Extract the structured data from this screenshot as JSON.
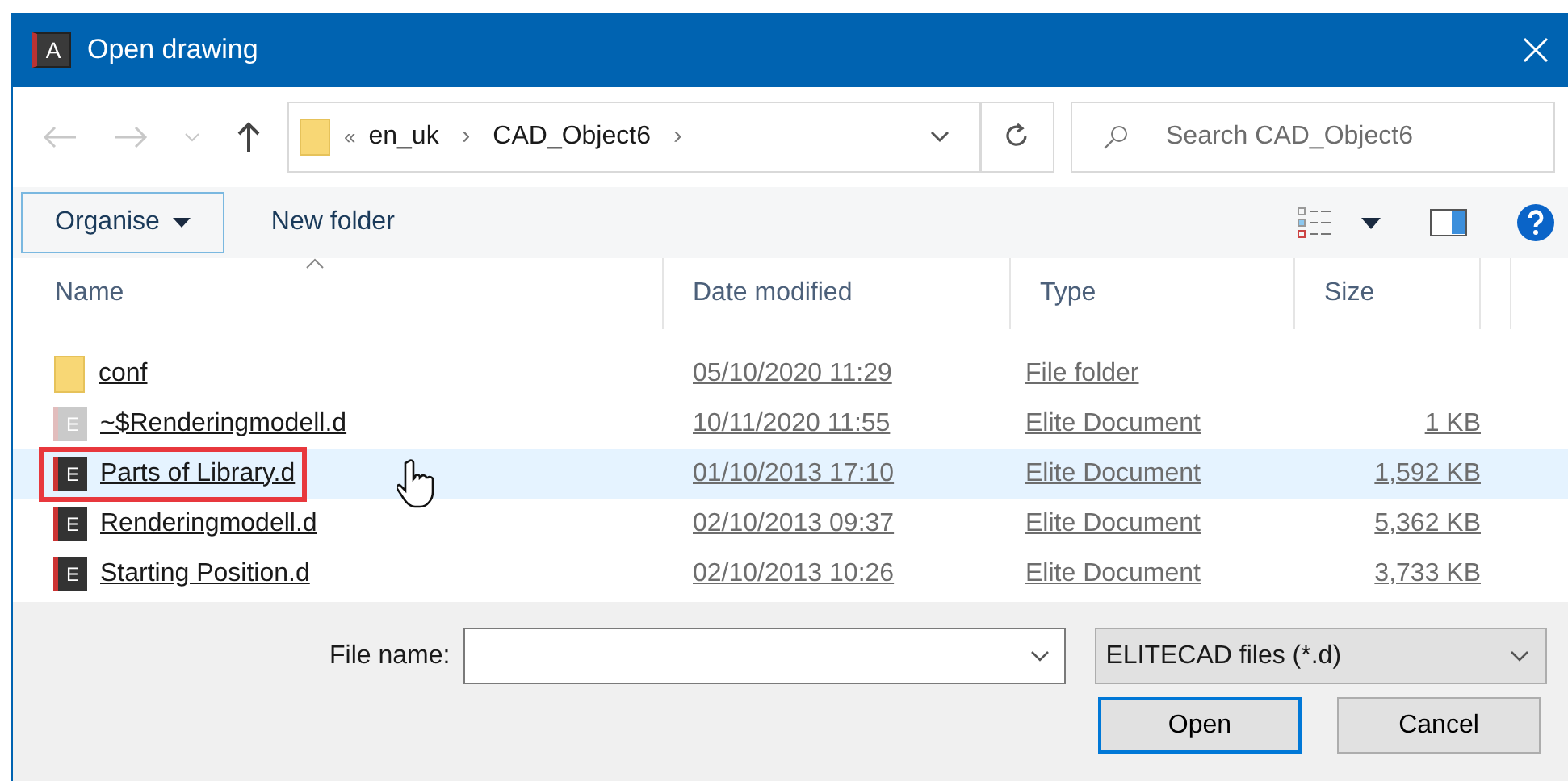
{
  "window": {
    "title": "Open drawing",
    "app_icon_letter": "A"
  },
  "navigation": {
    "overflow_marker": "«",
    "path": [
      {
        "label": "en_uk",
        "separator": "›"
      },
      {
        "label": "CAD_Object6",
        "separator": "›"
      }
    ],
    "search_placeholder": "Search CAD_Object6"
  },
  "toolbar": {
    "buttons": [
      {
        "label": "Organise",
        "dropdown": true,
        "focused": true
      },
      {
        "label": "New folder",
        "dropdown": false,
        "focused": false
      }
    ]
  },
  "table": {
    "columns": [
      {
        "label": "Name",
        "sorted": true
      },
      {
        "label": "Date modified",
        "sorted": false
      },
      {
        "label": "Type",
        "sorted": false
      },
      {
        "label": "Size",
        "sorted": false
      }
    ],
    "rows": [
      {
        "kind": "folder",
        "name": "conf",
        "date": "05/10/2020 11:29",
        "type": "File folder",
        "dimmed": false,
        "hovered": false,
        "outlined": false
      },
      {
        "kind": "document",
        "icon_letter": "E",
        "name": "~$Renderingmodell.d",
        "date": "10/11/2020 11:55",
        "type": "Elite Document",
        "size": "1 KB",
        "dimmed": true,
        "hovered": false,
        "outlined": false
      },
      {
        "kind": "document",
        "icon_letter": "E",
        "name": "Parts of Library.d",
        "date": "01/10/2013 17:10",
        "type": "Elite Document",
        "size": "1,592 KB",
        "dimmed": false,
        "hovered": true,
        "outlined": true
      },
      {
        "kind": "document",
        "icon_letter": "E",
        "name": "Renderingmodell.d",
        "date": "02/10/2013 09:37",
        "type": "Elite Document",
        "size": "5,362 KB",
        "dimmed": false,
        "hovered": false,
        "outlined": false
      },
      {
        "kind": "document",
        "icon_letter": "E",
        "name": "Starting Position.d",
        "date": "02/10/2013 10:26",
        "type": "Elite Document",
        "size": "3,733 KB",
        "dimmed": false,
        "hovered": false,
        "outlined": false
      }
    ]
  },
  "footer": {
    "file_name_label": "File name:",
    "filter": "ELITECAD files (*.d)",
    "buttons": [
      {
        "label": "Open",
        "default": true
      },
      {
        "label": "Cancel",
        "default": false
      }
    ]
  }
}
